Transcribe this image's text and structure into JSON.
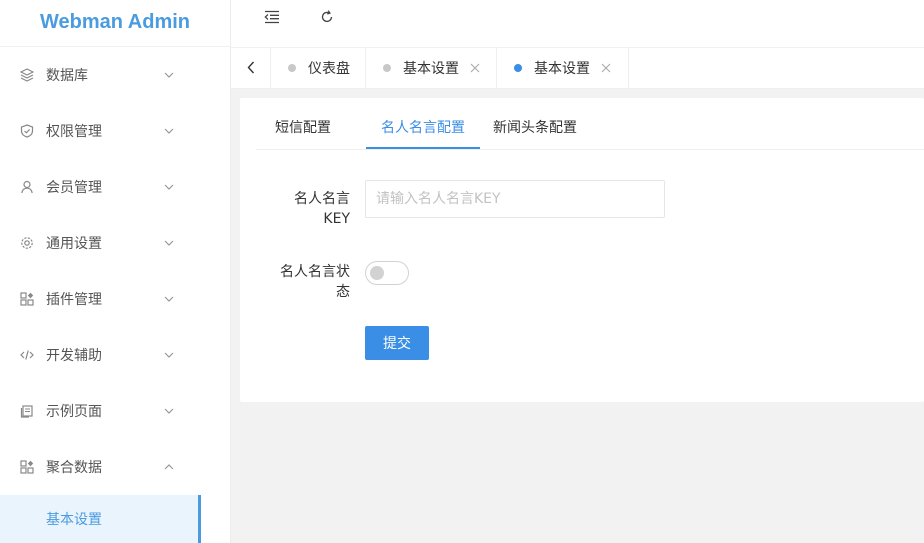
{
  "app": {
    "title": "Webman Admin"
  },
  "sidebar": {
    "items": [
      {
        "label": "数据库",
        "icon": "layers-icon",
        "expanded": false
      },
      {
        "label": "权限管理",
        "icon": "shield-icon",
        "expanded": false
      },
      {
        "label": "会员管理",
        "icon": "user-icon",
        "expanded": false
      },
      {
        "label": "通用设置",
        "icon": "gear-icon",
        "expanded": false
      },
      {
        "label": "插件管理",
        "icon": "plugin-icon",
        "expanded": false
      },
      {
        "label": "开发辅助",
        "icon": "code-icon",
        "expanded": false
      },
      {
        "label": "示例页面",
        "icon": "page-icon",
        "expanded": false
      },
      {
        "label": "聚合数据",
        "icon": "plugin-icon",
        "expanded": true
      }
    ],
    "sub_item": {
      "label": "基本设置",
      "active": true
    }
  },
  "header": {
    "menu_toggle_icon": "menu-fold-icon",
    "refresh_icon": "refresh-icon"
  },
  "tabs": [
    {
      "label": "仪表盘",
      "closable": false,
      "active": false
    },
    {
      "label": "基本设置",
      "closable": true,
      "active": false
    },
    {
      "label": "基本设置",
      "closable": true,
      "active": true
    }
  ],
  "content": {
    "subtabs": [
      {
        "label": "短信配置",
        "active": false
      },
      {
        "label": "名人名言配置",
        "active": true
      },
      {
        "label": "新闻头条配置",
        "active": false
      }
    ],
    "form": {
      "key_label_line1": "名人名言",
      "key_label_line2": "KEY",
      "key_input_value": "",
      "key_input_placeholder": "请输入名人名言KEY",
      "status_label_line1": "名人名言状",
      "status_label_line2": "态",
      "status_on": false,
      "submit_label": "提交"
    }
  },
  "colors": {
    "accent": "#3a8ee6",
    "brand": "#4a9be0",
    "background": "#f2f2f2"
  }
}
